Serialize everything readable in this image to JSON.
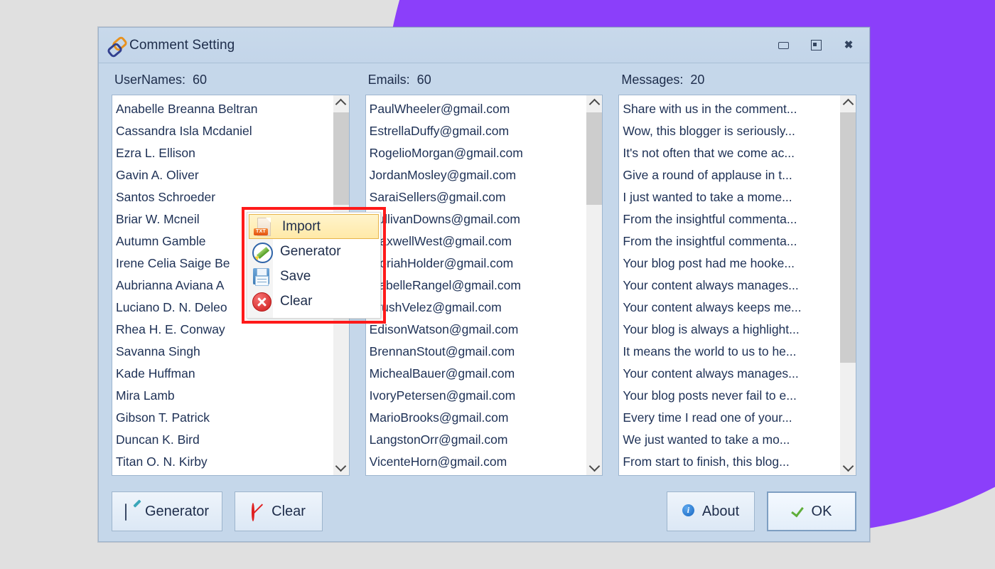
{
  "window": {
    "title": "Comment Setting",
    "icon": "broken-chain-icon",
    "controls": {
      "minimize": "–",
      "maximize": "□",
      "close": "✕"
    }
  },
  "theme": {
    "background": "#e0e0e0",
    "accent_purple": "#8B3FFA",
    "window_bg": "#c5d7ea",
    "text": "#1d2c4a",
    "highlight_border": "#ff1a1a"
  },
  "columns": [
    {
      "label": "UserNames:  60",
      "name": "usernames",
      "count": "60",
      "items": [
        "Anabelle Breanna Beltran",
        "Cassandra Isla Mcdaniel",
        "Ezra L. Ellison",
        "Gavin A. Oliver",
        "Santos Schroeder",
        "Briar W. Mcneil",
        "Autumn Gamble",
        "Irene Celia Saige Be",
        "Aubrianna Aviana A",
        "Luciano D. N. Deleo",
        "Rhea H. E. Conway",
        "Savanna Singh",
        "Kade Huffman",
        "Mira Lamb",
        "Gibson T. Patrick",
        "Duncan K. Bird",
        "Titan O. N. Kirby"
      ]
    },
    {
      "label": "Emails:  60",
      "name": "emails",
      "count": "60",
      "items": [
        "PaulWheeler@gmail.com",
        "EstrellaDuffy@gmail.com",
        "RogelioMorgan@gmail.com",
        "JordanMosley@gmail.com",
        "SaraiSellers@gmail.com",
        "SullivanDowns@gmail.com",
        "MaxwellWest@gmail.com",
        "MoriahHolder@gmail.com",
        "IsabelleRangel@gmail.com",
        "BrushVelez@gmail.com",
        "EdisonWatson@gmail.com",
        "BrennanStout@gmail.com",
        "MichealBauer@gmail.com",
        "IvoryPetersen@gmail.com",
        "MarioBrooks@gmail.com",
        "LangstonOrr@gmail.com",
        "VicenteHorn@gmail.com"
      ]
    },
    {
      "label": "Messages:  20",
      "name": "messages",
      "count": "20",
      "items": [
        "Share with us in the comment...",
        "Wow, this blogger is seriously...",
        "It's not often that we come ac...",
        "Give a round of applause  in t...",
        "I just wanted to take a mome...",
        "From the insightful commenta...",
        "From the insightful commenta...",
        "Your blog post had me hooke...",
        "Your content always manages...",
        "Your content always keeps me...",
        "Your blog is always a highlight...",
        "It means the world to us to he...",
        "Your content always manages...",
        "Your blog posts never fail to e...",
        "Every time I read one of your...",
        "We just wanted to take a mo...",
        "From start to finish, this blog..."
      ]
    }
  ],
  "context_menu": {
    "items": [
      {
        "label": "Import",
        "icon": "txt-file-icon",
        "active": true
      },
      {
        "label": "Generator",
        "icon": "pencil-circle-icon",
        "active": false
      },
      {
        "label": "Save",
        "icon": "floppy-disk-icon",
        "active": false
      },
      {
        "label": "Clear",
        "icon": "red-x-circle-icon",
        "active": false
      }
    ]
  },
  "footer": {
    "generator_label": "Generator",
    "clear_label": "Clear",
    "about_label": "About",
    "ok_label": "OK",
    "info_glyph": "i"
  }
}
